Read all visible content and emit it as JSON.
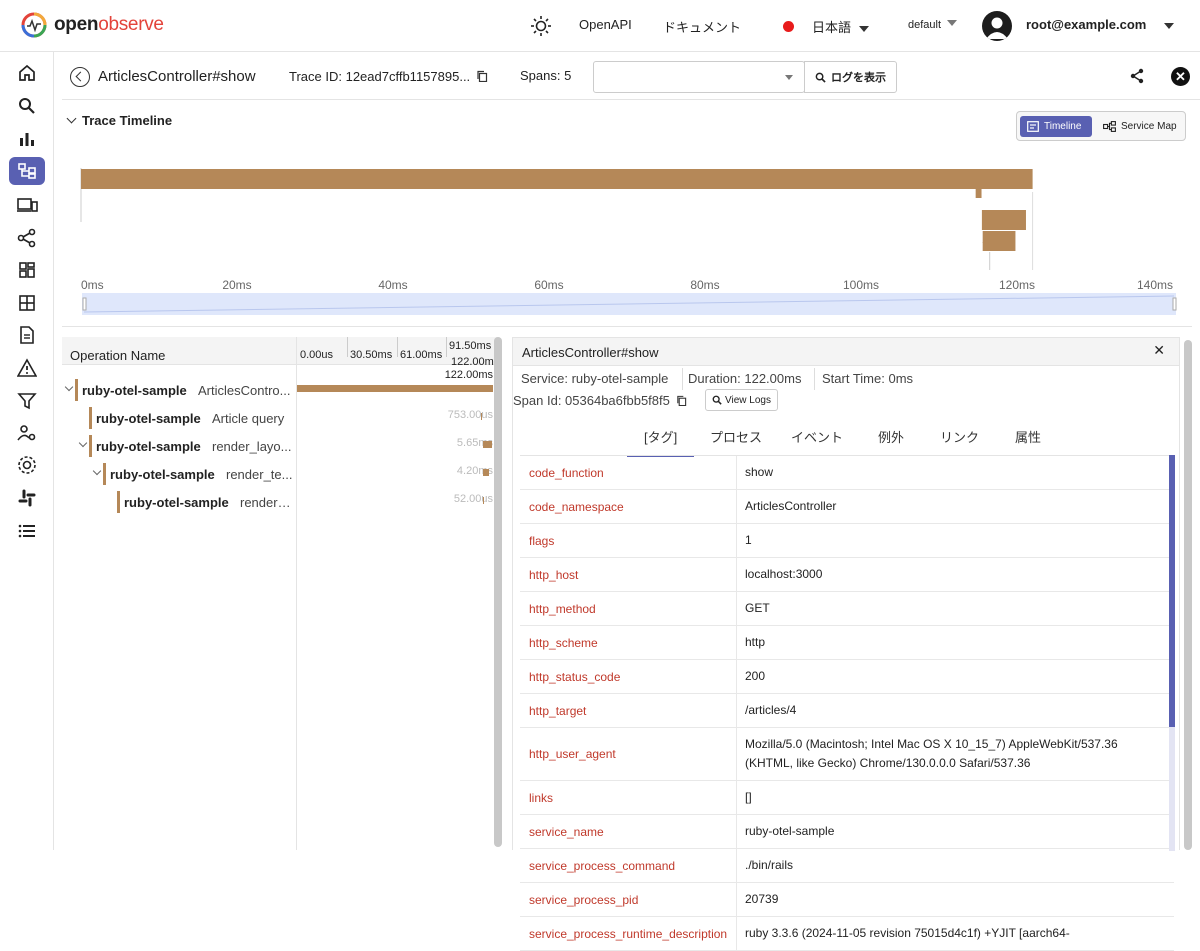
{
  "brand": {
    "logo_prefix": "open",
    "logo_suffix": "observe"
  },
  "topbar": {
    "openapi": "OpenAPI",
    "docs": "ドキュメント",
    "language": "日本語",
    "org": "default",
    "user": "root@example.com"
  },
  "sidebar": {
    "items": [
      "home-icon",
      "search-icon",
      "bar-chart-icon",
      "traces-icon",
      "devices-icon",
      "share-nodes-icon",
      "dashboard-icon",
      "grid-icon",
      "document-icon",
      "alert-icon",
      "filter-icon",
      "users-settings-icon",
      "gear-icon",
      "slack-icon",
      "list-icon"
    ],
    "active": "traces-icon"
  },
  "header": {
    "title": "ArticlesController#show",
    "trace_id": "Trace ID: 12ead7cffb1157895...",
    "spans": "Spans: 5",
    "view_logs_button": "ログを表示"
  },
  "timeline": {
    "section_title": "Trace Timeline",
    "toggle_timeline": "Timeline",
    "toggle_service_map": "Service Map",
    "axis_ticks": [
      "0ms",
      "20ms",
      "40ms",
      "60ms",
      "80ms",
      "100ms",
      "120ms",
      "140ms"
    ],
    "total_ms": 140,
    "spans_ms": [
      {
        "start": 0,
        "duration": 122.0
      },
      {
        "start": 114.7,
        "duration": 0.753
      },
      {
        "start": 115.5,
        "duration": 5.65
      },
      {
        "start": 115.6,
        "duration": 4.2
      },
      {
        "start": 115.6,
        "duration": 0.052
      }
    ]
  },
  "span_tree": {
    "header": "Operation Name",
    "ticks": [
      "0.00us",
      "30.50ms",
      "61.00ms",
      "91.50ms",
      "122.00ms"
    ],
    "total_label": "122.00ms",
    "rows": [
      {
        "service": "ruby-otel-sample",
        "operation": "ArticlesContro...",
        "duration": "122.00ms",
        "start_frac": 0.0,
        "width_frac": 1.0
      },
      {
        "service": "ruby-otel-sample",
        "operation": "Article query",
        "duration": "753.00us",
        "start_frac": 0.94,
        "width_frac": 0.006
      },
      {
        "service": "ruby-otel-sample",
        "operation": "render_layo...",
        "duration": "5.65ms",
        "start_frac": 0.947,
        "width_frac": 0.046
      },
      {
        "service": "ruby-otel-sample",
        "operation": "render_te...",
        "duration": "4.20ms",
        "start_frac": 0.948,
        "width_frac": 0.034
      },
      {
        "service": "ruby-otel-sample",
        "operation": "render_...",
        "duration": "52.00us",
        "start_frac": 0.948,
        "width_frac": 0.0004
      }
    ]
  },
  "detail": {
    "title": "ArticlesController#show",
    "service": "Service: ruby-otel-sample",
    "duration": "Duration: 122.00ms",
    "start_time": "Start Time: 0ms",
    "span_id": "Span Id: 05364ba6fbb5f8f5",
    "view_logs": "View Logs",
    "tabs": [
      "[タグ]",
      "プロセス",
      "イベント",
      "例外",
      "リンク",
      "属性"
    ],
    "tags": [
      {
        "key": "code_function",
        "value": "show"
      },
      {
        "key": "code_namespace",
        "value": "ArticlesController"
      },
      {
        "key": "flags",
        "value": "1"
      },
      {
        "key": "http_host",
        "value": "localhost:3000"
      },
      {
        "key": "http_method",
        "value": "GET"
      },
      {
        "key": "http_scheme",
        "value": "http"
      },
      {
        "key": "http_status_code",
        "value": "200"
      },
      {
        "key": "http_target",
        "value": "/articles/4"
      },
      {
        "key": "http_user_agent",
        "value": "Mozilla/5.0 (Macintosh; Intel Mac OS X 10_15_7) AppleWebKit/537.36 (KHTML, like Gecko) Chrome/130.0.0.0 Safari/537.36"
      },
      {
        "key": "links",
        "value": "[]"
      },
      {
        "key": "service_name",
        "value": "ruby-otel-sample"
      },
      {
        "key": "service_process_command",
        "value": "./bin/rails"
      },
      {
        "key": "service_process_pid",
        "value": "20739"
      },
      {
        "key": "service_process_runtime_description",
        "value": "ruby 3.3.6 (2024-11-05 revision 75015d4c1f) +YJIT [aarch64-"
      }
    ]
  },
  "colors": {
    "accent": "#5960b2",
    "span_bar": "#b58858",
    "tag_key": "#c0392b"
  }
}
